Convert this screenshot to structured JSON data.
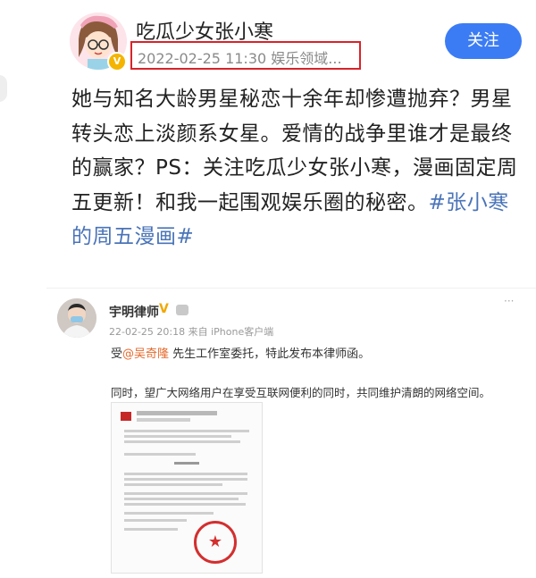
{
  "post": {
    "author": "吃瓜少女张小寒",
    "meta": "2022-02-25 11:30  娱乐领域...",
    "follow_label": "关注",
    "text": "她与知名大龄男星秘恋十余年却惨遭抛弃？男星转头恋上淡颜系女星。爱情的战争里谁才是最终的赢家？PS：关注吃瓜少女张小寒，漫画固定周五更新！和我一起围观娱乐圈的秘密。",
    "hashtag": "#张小寒的周五漫画#",
    "verified_badge": "V"
  },
  "embedded": {
    "author": "宇明律师",
    "verified_badge": "V",
    "meta": "22-02-25 20:18 来自 iPhone客户端",
    "line1_prefix": "受",
    "mention": "@吴奇隆",
    "line1_suffix": " 先生工作室委托，特此发布本律师函。",
    "line2": "同时，望广大网络用户在享受互联网便利的同时，共同维护清朗的网络空间。",
    "more": "···"
  },
  "document": {
    "seal_symbol": "★"
  },
  "colors": {
    "accent": "#3b7cf4",
    "hashtag": "#4a74b8",
    "mention": "#e66a2c",
    "highlight_border": "#d8232a"
  }
}
